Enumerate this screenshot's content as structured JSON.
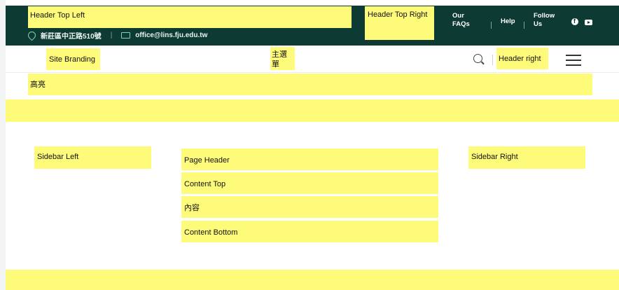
{
  "topbar": {
    "header_top_left": "Header Top Left",
    "header_top_right": "Header Top Right",
    "address": "新莊區中正路510號",
    "email": "office@lins.fju.edu.tw",
    "links": [
      "Our FAQs",
      "Help",
      "Follow Us"
    ],
    "social_icons": [
      "facebook-icon",
      "youtube-icon"
    ],
    "bg_color": "#0d3b33"
  },
  "header": {
    "site_branding": "Site Branding",
    "main_menu": "主選單",
    "header_right": "Header right",
    "icons": [
      "search-icon",
      "menu-icon"
    ]
  },
  "highlight": "高亮",
  "sidebar_left": "Sidebar Left",
  "sidebar_right": "Sidebar Right",
  "content": {
    "page_header": "Page Header",
    "content_top": "Content Top",
    "body": "內容",
    "content_bottom": "Content Bottom"
  },
  "colors": {
    "region": "#fffb7a",
    "accent": "#7fd1b3"
  }
}
